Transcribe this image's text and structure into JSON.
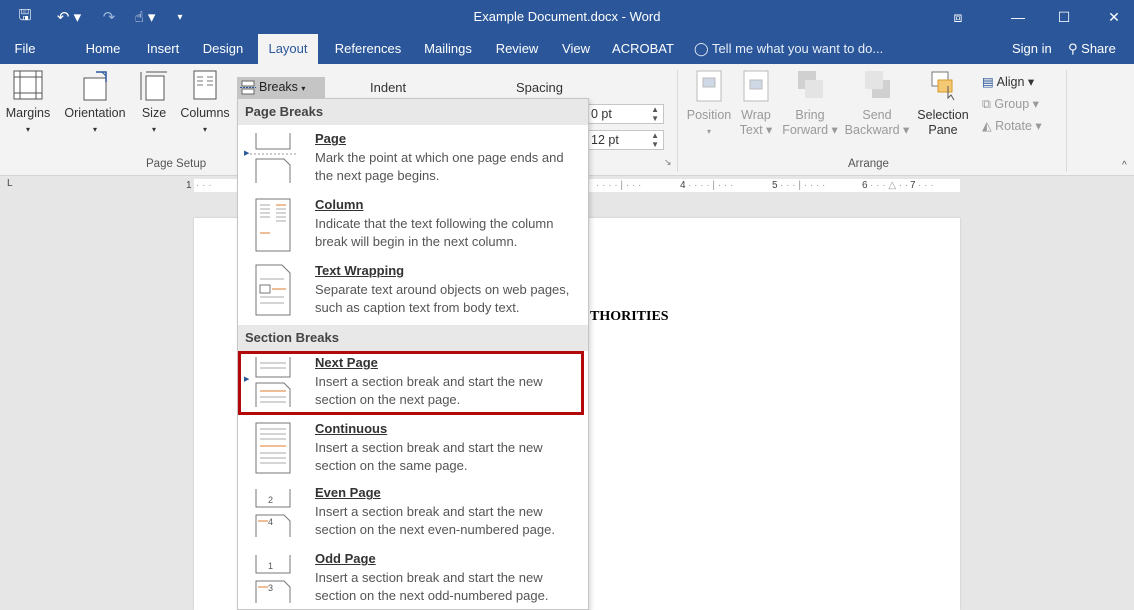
{
  "window": {
    "title": "Example Document.docx - Word",
    "qa_icons": [
      "save-icon",
      "undo-icon",
      "redo-icon",
      "touch-mode-icon",
      "customize-icon"
    ],
    "qa_glyphs": {
      "save": "🖫",
      "undo": "↶ ▾",
      "redo": "↷",
      "touch": "☝ ▾",
      "customize": "▾"
    },
    "controls": {
      "restore_ribbon": "⧈",
      "minimize": "—",
      "maximize": "☐",
      "close": "✕"
    }
  },
  "tabs": [
    "File",
    "Home",
    "Insert",
    "Design",
    "Layout",
    "References",
    "Mailings",
    "Review",
    "View",
    "ACROBAT"
  ],
  "active_tab": "Layout",
  "tellme": "Tell me what you want to do...",
  "signin": "Sign in",
  "share": "Share",
  "ribbon": {
    "page_setup": {
      "margins": "Margins",
      "orientation": "Orientation",
      "size": "Size",
      "columns": "Columns",
      "breaks": "Breaks",
      "label": "Page Setup"
    },
    "paragraph": {
      "indent": "Indent",
      "spacing": "Spacing",
      "spacing_before": "0 pt",
      "spacing_after": "12 pt"
    },
    "arrange": {
      "position": "Position",
      "wrap_text": "Wrap Text",
      "bring_forward": "Bring Forward",
      "send_backward": "Send Backward",
      "selection_pane": "Selection Pane",
      "align": "Align",
      "group": "Group",
      "rotate": "Rotate",
      "label": "Arrange"
    }
  },
  "ruler": {
    "corner": "L",
    "marks": [
      "1",
      "4",
      "5",
      "6",
      "7"
    ]
  },
  "document": {
    "visible_text": "THORITIES"
  },
  "breaks_menu": {
    "page_breaks_header": "Page Breaks",
    "section_breaks_header": "Section Breaks",
    "page_breaks": [
      {
        "title": "Page",
        "desc": "Mark the point at which one page ends and the next page begins.",
        "icon": "page-break-icon"
      },
      {
        "title": "Column",
        "desc": "Indicate that the text following the column break will begin in the next column.",
        "icon": "column-break-icon"
      },
      {
        "title": "Text Wrapping",
        "desc": "Separate text around objects on web pages, such as caption text from body text.",
        "icon": "text-wrapping-break-icon"
      }
    ],
    "section_breaks": [
      {
        "title": "Next Page",
        "desc": "Insert a section break and start the new section on the next page.",
        "icon": "next-page-break-icon"
      },
      {
        "title": "Continuous",
        "desc": "Insert a section break and start the new section on the same page.",
        "icon": "continuous-break-icon"
      },
      {
        "title": "Even Page",
        "desc": "Insert a section break and start the new section on the next even-numbered page.",
        "icon": "even-page-break-icon"
      },
      {
        "title": "Odd Page",
        "desc": "Insert a section break and start the new section on the next odd-numbered page.",
        "icon": "odd-page-break-icon"
      }
    ]
  },
  "colors": {
    "brand": "#2b579a",
    "highlight_box": "#b3070a",
    "break_icon_accent": "#e07b2a"
  }
}
